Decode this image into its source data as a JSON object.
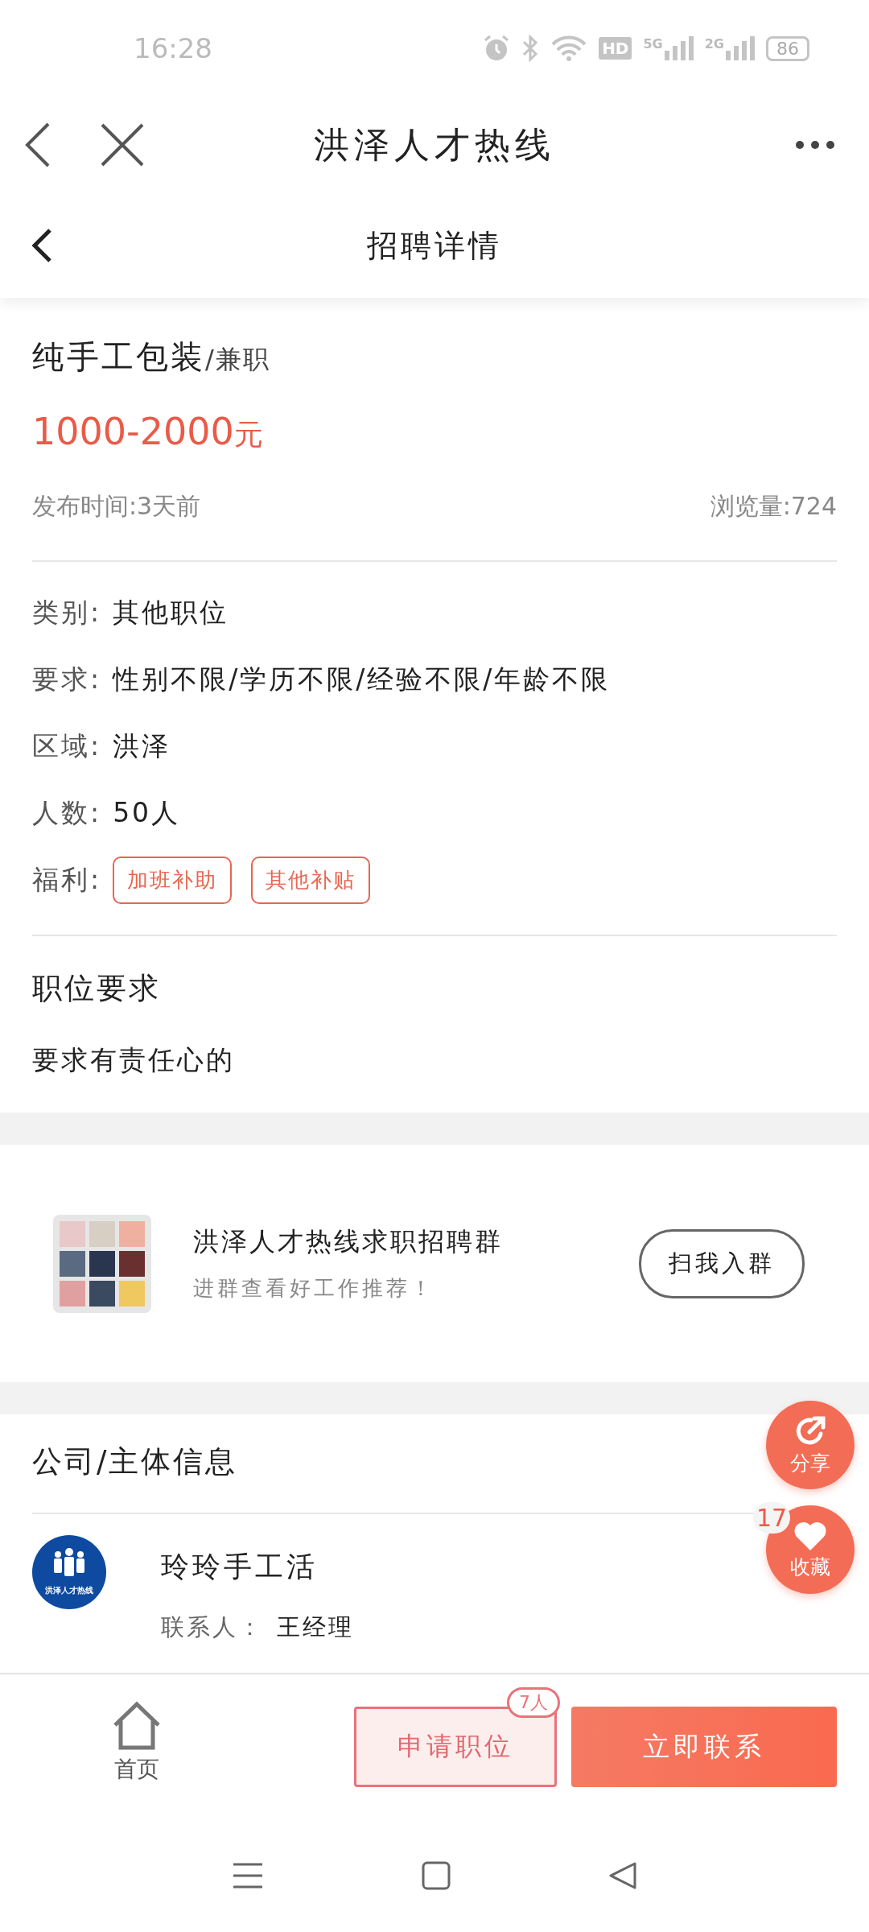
{
  "status_bar": {
    "time": "16:28",
    "hd": "HD",
    "network_1": "5G",
    "network_2": "2G",
    "battery": "86"
  },
  "app_bar": {
    "title": "洪泽人才热线"
  },
  "page_header": {
    "title": "招聘详情"
  },
  "job": {
    "title": "纯手工包装",
    "type": "/兼职",
    "salary": "1000-2000",
    "salary_unit": "元",
    "posted": "发布时间:3天前",
    "views": "浏览量:724"
  },
  "details": [
    {
      "kind": "text",
      "label": "类别:",
      "value": "其他职位"
    },
    {
      "kind": "text",
      "label": "要求:",
      "value": "性别不限/学历不限/经验不限/年龄不限"
    },
    {
      "kind": "text",
      "label": "区域:",
      "value": "洪泽"
    },
    {
      "kind": "text",
      "label": "人数:",
      "value": "50人"
    },
    {
      "kind": "tags",
      "label": "福利:",
      "tags": [
        "加班补助",
        "其他补贴"
      ]
    }
  ],
  "requirements": {
    "title": "职位要求",
    "text": "要求有责任心的"
  },
  "group": {
    "name": "洪泽人才热线求职招聘群",
    "subtitle": "进群查看好工作推荐！",
    "button": "扫我入群"
  },
  "company_section": {
    "title": "公司/主体信息",
    "logo_text": "洪泽人才热线",
    "name": "玲玲手工活",
    "contact_label": "联系人：",
    "contact": "王经理"
  },
  "floating": [
    {
      "kind": "share",
      "label": "分享"
    },
    {
      "kind": "favorite",
      "label": "收藏",
      "count": "17"
    }
  ],
  "bottom_bar": {
    "home": "首页",
    "apply": "申请职位",
    "apply_count": "7人",
    "contact": "立即联系"
  }
}
